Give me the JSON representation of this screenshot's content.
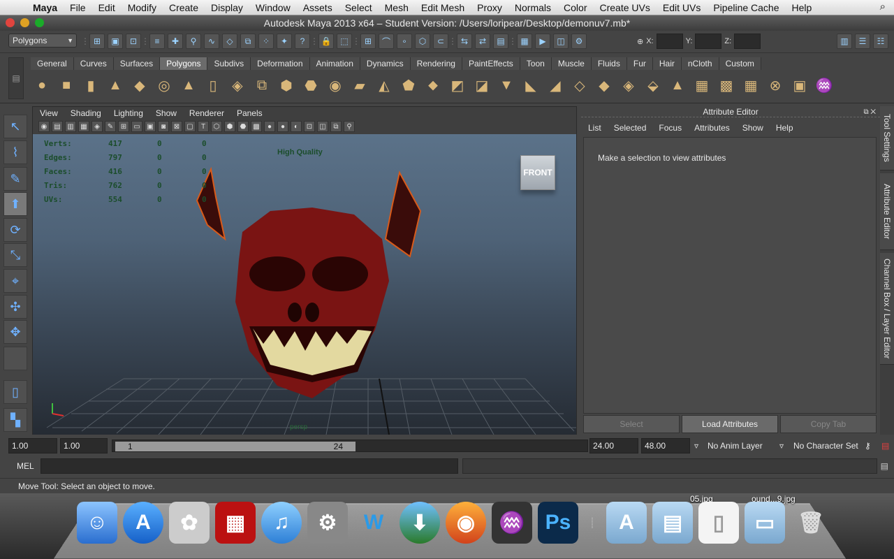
{
  "menubar": {
    "app": "Maya",
    "items": [
      "File",
      "Edit",
      "Modify",
      "Create",
      "Display",
      "Window",
      "Assets",
      "Select",
      "Mesh",
      "Edit Mesh",
      "Proxy",
      "Normals",
      "Color",
      "Create UVs",
      "Edit UVs",
      "Pipeline Cache",
      "Help"
    ]
  },
  "window": {
    "title": "Autodesk Maya 2013 x64 – Student Version: /Users/loripear/Desktop/demonuv7.mb*"
  },
  "statusline": {
    "mode": "Polygons",
    "x_label": "X:",
    "y_label": "Y:",
    "z_label": "Z:"
  },
  "shelf": {
    "tabs": [
      "General",
      "Curves",
      "Surfaces",
      "Polygons",
      "Subdivs",
      "Deformation",
      "Animation",
      "Dynamics",
      "Rendering",
      "PaintEffects",
      "Toon",
      "Muscle",
      "Fluids",
      "Fur",
      "Hair",
      "nCloth",
      "Custom"
    ],
    "active_tab": "Polygons"
  },
  "viewport": {
    "menu": [
      "View",
      "Shading",
      "Lighting",
      "Show",
      "Renderer",
      "Panels"
    ],
    "hud": [
      {
        "label": "Verts:",
        "v1": "417",
        "v2": "0",
        "v3": "0"
      },
      {
        "label": "Edges:",
        "v1": "797",
        "v2": "0",
        "v3": "0"
      },
      {
        "label": "Faces:",
        "v1": "416",
        "v2": "0",
        "v3": "0"
      },
      {
        "label": "Tris:",
        "v1": "762",
        "v2": "0",
        "v3": "0"
      },
      {
        "label": "UVs:",
        "v1": "554",
        "v2": "0",
        "v3": "0"
      }
    ],
    "quality": "High Quality",
    "viewcube": "FRONT",
    "camera": "persp"
  },
  "attribute_editor": {
    "title": "Attribute Editor",
    "menu": [
      "List",
      "Selected",
      "Focus",
      "Attributes",
      "Show",
      "Help"
    ],
    "message": "Make a selection to view attributes",
    "buttons": [
      "Select",
      "Load Attributes",
      "Copy Tab"
    ]
  },
  "side_tabs": [
    "Tool Settings",
    "Attribute Editor",
    "Channel Box / Layer Editor"
  ],
  "range": {
    "start": "1.00",
    "playback_start": "1.00",
    "slider_start": "1",
    "slider_end": "24",
    "playback_end": "24.00",
    "end": "48.00",
    "anim_layer": "No Anim Layer",
    "character_set": "No Character Set"
  },
  "command": {
    "label": "MEL"
  },
  "help": {
    "text": "Move Tool: Select an object to move."
  },
  "dock": {
    "label_a": "05.jpg",
    "label_b": "ound...9.jpg"
  }
}
